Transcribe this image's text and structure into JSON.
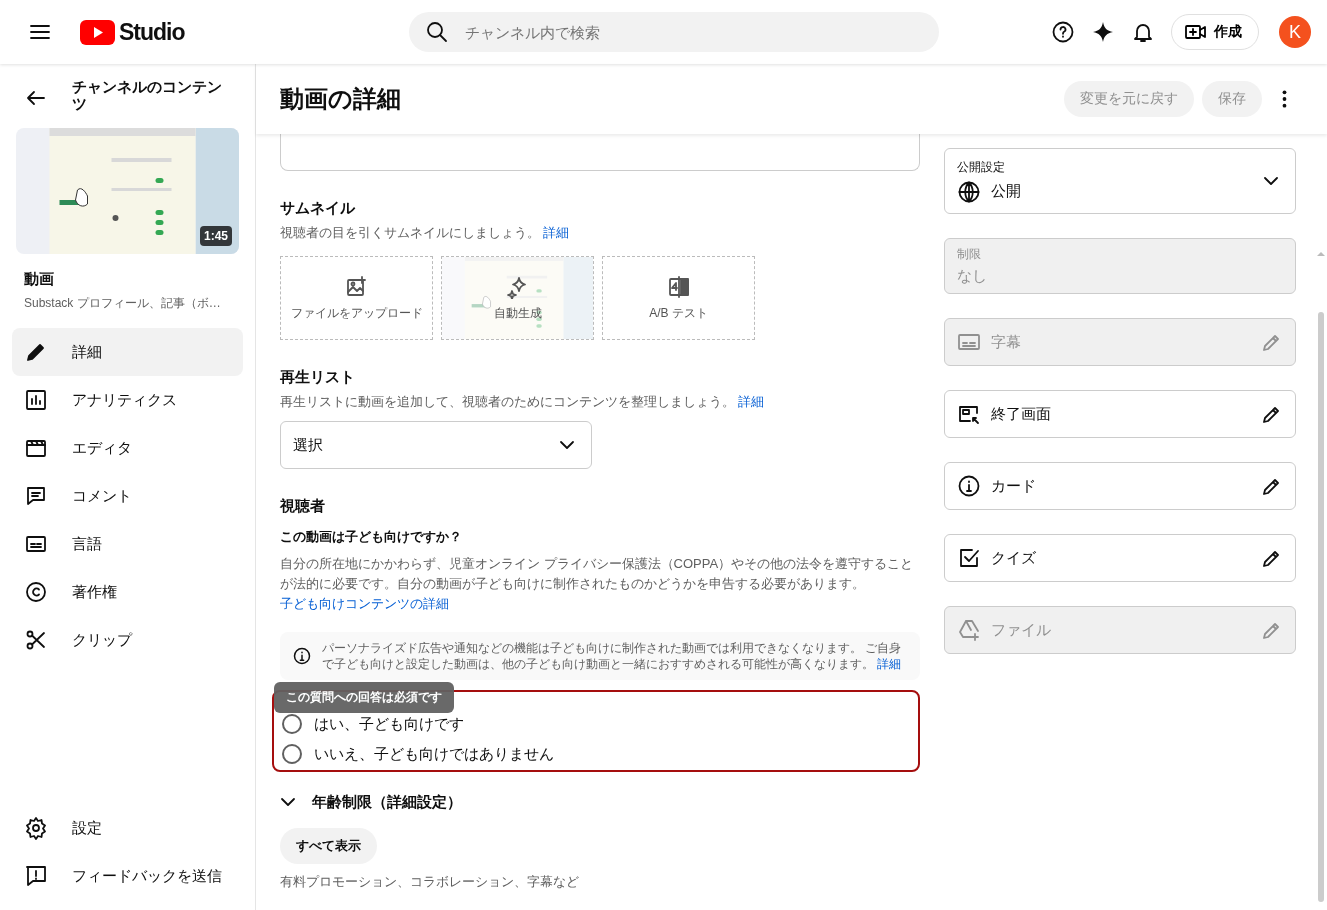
{
  "topbar": {
    "logo_text": "Studio",
    "search": {
      "placeholder": "チャンネル内で検索"
    },
    "create_button": "作成",
    "avatar": "K"
  },
  "sidebar": {
    "back_title": "チャンネルのコンテンツ",
    "video": {
      "duration": "1:45",
      "title": "動画",
      "subtitle": "Substack プロフィール、記事（ボ…"
    },
    "nav": [
      {
        "label": "詳細",
        "selected": true
      },
      {
        "label": "アナリティクス",
        "selected": false
      },
      {
        "label": "エディタ",
        "selected": false
      },
      {
        "label": "コメント",
        "selected": false
      },
      {
        "label": "言語",
        "selected": false
      },
      {
        "label": "著作権",
        "selected": false
      },
      {
        "label": "クリップ",
        "selected": false
      }
    ],
    "footer": [
      {
        "label": "設定"
      },
      {
        "label": "フィードバックを送信"
      }
    ]
  },
  "header": {
    "title": "動画の詳細",
    "buttons": [
      {
        "label": "変更を元に戻す",
        "disabled": true
      },
      {
        "label": "保存",
        "disabled": true
      }
    ]
  },
  "thumbnail": {
    "title": "サムネイル",
    "description": "視聴者の目を引くサムネイルにしましょう。",
    "link": "詳細",
    "options": [
      {
        "kind": "upload",
        "label": "ファイルをアップロード"
      },
      {
        "kind": "auto",
        "label": "自動生成"
      },
      {
        "kind": "ab",
        "label": "A/B テスト"
      }
    ]
  },
  "playlist": {
    "title": "再生リスト",
    "description": "再生リストに動画を追加して、視聴者のためにコンテンツを整理しましょう。",
    "link": "詳細",
    "select": "選択"
  },
  "audience": {
    "title": "視聴者",
    "question": "この動画は子ども向けですか？",
    "description": "自分の所在地にかかわらず、児童オンライン プライバシー保護法（COPPA）やその他の法令を遵守することが法的に必要です。自分の動画が子ども向けに制作されたものかどうかを申告する必要があります。",
    "link": "子ども向けコンテンツの詳細",
    "info": "パーソナライズド広告や通知などの機能は子ども向けに制作された動画では利用できなくなります。 ご自身で子ども向けと設定した動画は、他の子ども向け動画と一緒におすすめされる可能性が高くなります。",
    "info_link": "詳細",
    "invalid": true,
    "tooltip": "この質問への回答は必須です",
    "options": [
      {
        "label": "はい、子ども向けです",
        "selected": false
      },
      {
        "label": "いいえ、子ども向けではありません",
        "selected": false
      }
    ]
  },
  "age": {
    "title": "年齢制限（詳細設定）",
    "expanded": false,
    "show_all": "すべて表示",
    "description": "有料プロモーション、コラボレーション、字幕など"
  },
  "panel": [
    {
      "kind": "select",
      "label": "公開設定",
      "value": "公開"
    },
    {
      "kind": "field",
      "label": "制限",
      "value": "なし"
    },
    {
      "kind": "action",
      "label": "字幕",
      "disabled": true
    },
    {
      "kind": "action",
      "label": "終了画面",
      "disabled": false
    },
    {
      "kind": "action",
      "label": "カード",
      "disabled": false
    },
    {
      "kind": "action",
      "label": "クイズ",
      "disabled": false
    },
    {
      "kind": "action",
      "label": "ファイル",
      "disabled": true
    }
  ]
}
